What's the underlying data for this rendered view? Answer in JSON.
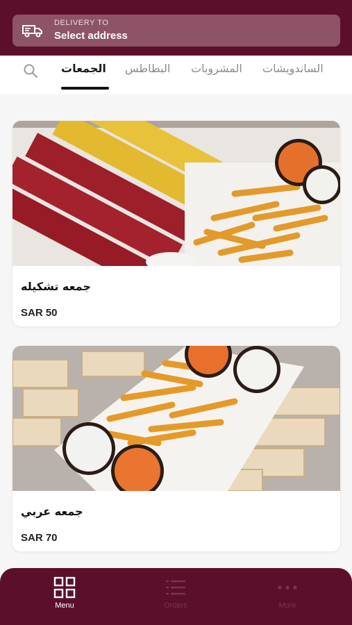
{
  "delivery": {
    "caption": "DELIVERY TO",
    "value": "Select address"
  },
  "tabs": [
    {
      "label": "الجمعات",
      "active": true
    },
    {
      "label": "البطاطس",
      "active": false
    },
    {
      "label": "المشروبات",
      "active": false
    },
    {
      "label": "الساندويشات",
      "active": false
    }
  ],
  "products": [
    {
      "name": "جمعه تشكيله",
      "price": "SAR 50"
    },
    {
      "name": "جمعه عربي",
      "price": "SAR 70"
    }
  ],
  "bottom_nav": [
    {
      "label": "Menu",
      "icon": "grid-icon",
      "active": true
    },
    {
      "label": "Orders",
      "icon": "list-icon",
      "active": false
    },
    {
      "label": "More",
      "icon": "more-icon",
      "active": false
    }
  ],
  "colors": {
    "brand": "#5b0f2a",
    "address_box": "#8d5367",
    "inactive_nav": "#7a3350"
  }
}
